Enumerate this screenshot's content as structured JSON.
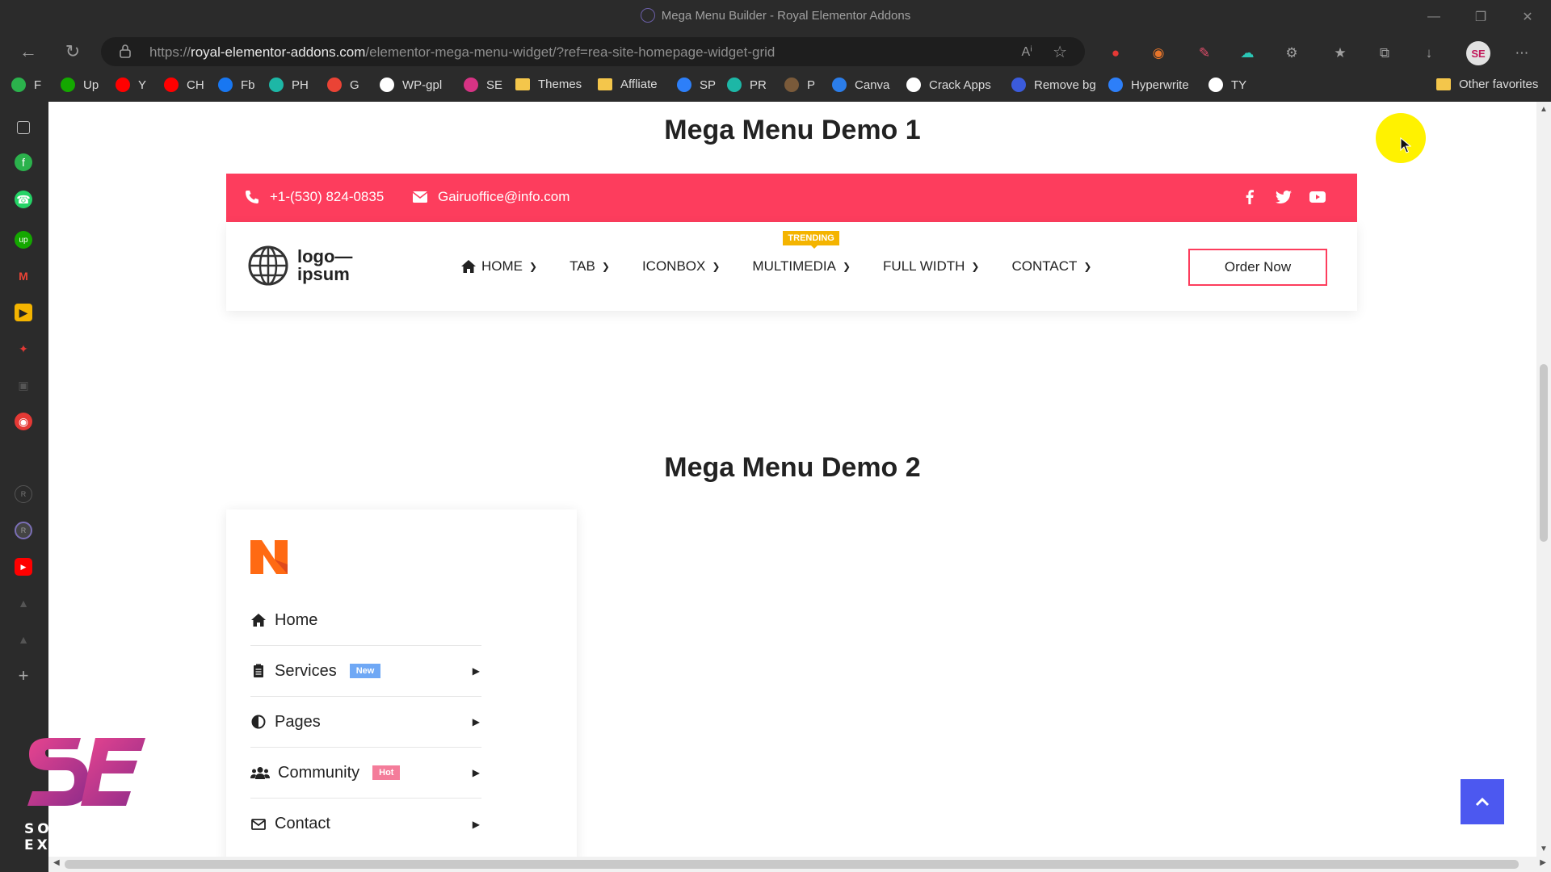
{
  "window": {
    "title": "Mega Menu Builder - Royal Elementor Addons"
  },
  "address_bar": {
    "url_prefix": "https://",
    "url_domain": "royal-elementor-addons.com",
    "url_path": "/elementor-mega-menu-widget/?ref=rea-site-homepage-widget-grid"
  },
  "bookmarks": [
    {
      "label": "F",
      "icon": "feedly-icon",
      "color": "#2bb24c"
    },
    {
      "label": "Up",
      "icon": "upwork-icon",
      "color": "#14a800"
    },
    {
      "label": "Y",
      "icon": "youtube-icon",
      "color": "#ff0000"
    },
    {
      "label": "CH",
      "icon": "youtube-icon",
      "color": "#ff0000"
    },
    {
      "label": "Fb",
      "icon": "facebook-icon",
      "color": "#1877f2"
    },
    {
      "label": "PH",
      "icon": "ph-icon",
      "color": "#1db7a6"
    },
    {
      "label": "G",
      "icon": "gmail-icon",
      "color": "#ea4335"
    },
    {
      "label": "WP-gpl",
      "icon": "wp-gpl-icon",
      "color": "#ffffff"
    },
    {
      "label": "SE",
      "icon": "se-icon",
      "color": "#d63384"
    },
    {
      "label": "Themes",
      "icon": "folder-icon",
      "color": "#f4c64b"
    },
    {
      "label": "Affliate",
      "icon": "folder-icon",
      "color": "#f4c64b"
    },
    {
      "label": "SP",
      "icon": "sp-icon",
      "color": "#2d7ff9"
    },
    {
      "label": "PR",
      "icon": "pr-icon",
      "color": "#1db7a6"
    },
    {
      "label": "P",
      "icon": "person-icon",
      "color": "#7a5a3a"
    },
    {
      "label": "Canva",
      "icon": "canva-icon",
      "color": "#2b7de9"
    },
    {
      "label": "Crack Apps",
      "icon": "wordpress-icon",
      "color": "#ffffff"
    },
    {
      "label": "Remove bg",
      "icon": "removebg-icon",
      "color": "#3b5bdb"
    },
    {
      "label": "Hyperwrite",
      "icon": "hyperwrite-icon",
      "color": "#2d7ff9"
    },
    {
      "label": "TY",
      "icon": "ty-icon",
      "color": "#ffffff"
    }
  ],
  "other_favorites": "Other favorites",
  "page": {
    "demo1_title": "Mega Menu Demo 1",
    "demo2_title": "Mega Menu Demo 2",
    "topbar": {
      "phone": "+1-(530) 824-0835",
      "email": "Gairuoffice@info.com",
      "bg_color": "#fd3d5d"
    },
    "logo_line1": "logo—",
    "logo_line2": "ipsum",
    "menu": [
      {
        "label": "HOME",
        "icon": "home-icon"
      },
      {
        "label": "TAB"
      },
      {
        "label": "ICONBOX"
      },
      {
        "label": "MULTIMEDIA",
        "badge": "TRENDING"
      },
      {
        "label": "FULL WIDTH"
      },
      {
        "label": "CONTACT"
      }
    ],
    "order_button": "Order Now",
    "vertical_menu": [
      {
        "label": "Home",
        "icon": "home-icon"
      },
      {
        "label": "Services",
        "icon": "clipboard-icon",
        "tag": "New",
        "tag_color": "#6fa8f5"
      },
      {
        "label": "Pages",
        "icon": "half-circle-icon"
      },
      {
        "label": "Community",
        "icon": "users-icon",
        "tag": "Hot",
        "tag_color": "#f47c9a"
      },
      {
        "label": "Contact",
        "icon": "envelope-icon"
      }
    ]
  },
  "watermark": {
    "text": "SOFT EXPERT"
  }
}
